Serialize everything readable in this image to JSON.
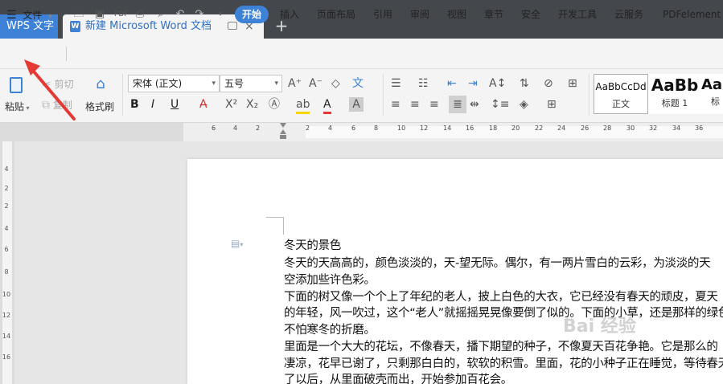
{
  "app": {
    "name": "WPS 文字"
  },
  "tabs": {
    "doc_title": "新建 Microsoft Word 文档",
    "doc_icon": "W",
    "close": "×",
    "new_tab": "+"
  },
  "menubar": {
    "file": "文件",
    "tabs": [
      "开始",
      "插入",
      "页面布局",
      "引用",
      "审阅",
      "视图",
      "章节",
      "安全",
      "开发工具",
      "云服务",
      "PDFelement"
    ]
  },
  "ribbon": {
    "paste": "粘贴",
    "cut": "剪切",
    "copy": "复制",
    "format_painter": "格式刷",
    "font_name": "宋体 (正文)",
    "font_size": "五号",
    "bold": "B",
    "italic": "I",
    "underline": "U",
    "styles": [
      {
        "preview": "AaBbCcDd",
        "name": "正文"
      },
      {
        "preview": "AaBb",
        "name": "标题 1"
      },
      {
        "preview": "AaE",
        "name": "标"
      }
    ]
  },
  "ruler": {
    "ticks": [
      "6",
      "4",
      "2",
      "2",
      "4",
      "6",
      "8",
      "10",
      "12",
      "14",
      "16",
      "18",
      "20",
      "22",
      "24",
      "26",
      "28",
      "30",
      "32",
      "34",
      "36",
      "38"
    ],
    "vticks": [
      "4",
      "2",
      "2",
      "4",
      "6",
      "8",
      "10",
      "12",
      "14",
      "16"
    ]
  },
  "document": {
    "lines": [
      "冬天的景色",
      "冬天的天高高的，颜色淡淡的，天-望无际。偶尔，有一两片雪白的云彩，为淡淡的天",
      "空添加些许色彩。",
      "下面的树又像一个个上了年纪的老人，披上白色的大衣，它已经没有春天的顽皮，夏天",
      "的年轻，风一吹过，这个“老人”就摇摇晃晃像要倒了似的。下面的小草，还是那样的绿色",
      "不怕寒冬的折磨。",
      "里面是一个大大的花坛，不像春天，播下期望的种子，不像夏天百花争艳。它是那么的",
      "凄凉，花早已谢了，只剩那白白的，软软的积雪。里面，花的小种子正在睡觉，等待春天晓",
      "了以后，从里面破壳而出，开始参加百花会。"
    ]
  },
  "watermark": "Bai 经验",
  "colors": {
    "accent": "#3d82d6",
    "titlebar": "#44474c",
    "arrow": "#e53935"
  }
}
